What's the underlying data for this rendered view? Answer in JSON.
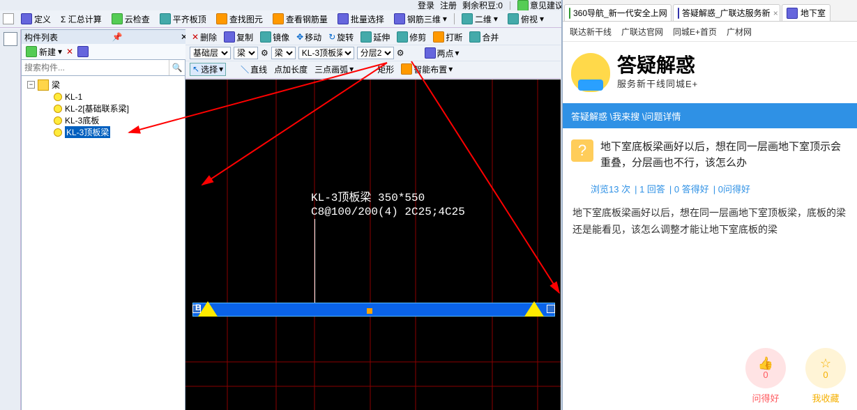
{
  "topbar": {
    "login": "登录",
    "register": "注册",
    "integral_label": "剩余积豆:0",
    "feedback": "意见建议",
    "items": [
      "定义",
      "Σ 汇总计算",
      "云检查",
      "平齐板顶",
      "查找图元",
      "查看钢筋量",
      "批量选择",
      "钢筋三维"
    ],
    "view2d": "二维",
    "ortho": "俯视"
  },
  "row2": {
    "items": [
      "删除",
      "复制",
      "镜像",
      "移动",
      "旋转",
      "延伸",
      "修剪",
      "打断",
      "合并"
    ]
  },
  "panel": {
    "title": "构件列表",
    "new": "新建",
    "search_placeholder": "搜索构件...",
    "root": "梁",
    "leaves": [
      "KL-1",
      "KL-2[基础联系梁]",
      "KL-3底板",
      "KL-3顶板梁"
    ],
    "selected": 3
  },
  "ctb": {
    "row1": {
      "floor": "基础层",
      "cat": "梁",
      "sub": "梁",
      "member": "KL-3顶板梁",
      "layer": "分层2",
      "mode": "两点"
    },
    "row2": {
      "select": "选择",
      "line": "直线",
      "addlen": "点加长度",
      "arc3": "三点画弧",
      "rect": "矩形",
      "smart": "智能布置"
    }
  },
  "canvas": {
    "dim1": "KL-3顶板梁 350*550",
    "dim2": "C8@100/200(4) 2C25;4C25",
    "blabel": "B"
  },
  "browser": {
    "tabs": [
      {
        "title": "360导航_新一代安全上网",
        "icon": "g"
      },
      {
        "title": "答疑解惑_广联达服务新",
        "icon": "b"
      },
      {
        "title": "地下室",
        "icon": "b"
      }
    ],
    "fav": [
      "联达新干线",
      "广联达官网",
      "同城E+首页",
      "广材网"
    ],
    "brand_title": "答疑解惑",
    "brand_sub": "服务新干线同城E+",
    "crumb": "答疑解惑 \\我来搜 \\问题详情",
    "question": "地下室底板梁画好以后，想在同一层画地下室顶示会重叠，分层画也不行，该怎么办",
    "stats": {
      "views": "浏览13 次",
      "answers": "1 回答",
      "good": "0 答得好",
      "q_good": "0问得好"
    },
    "body": "地下室底板梁画好以后，想在同一层画地下室顶板梁，底板的梁还是能看见，该怎么调整才能让地下室底板的梁",
    "vote_up": "0",
    "vote_fav": "0",
    "vote_up_label": "问得好",
    "vote_fav_label": "我收藏"
  }
}
